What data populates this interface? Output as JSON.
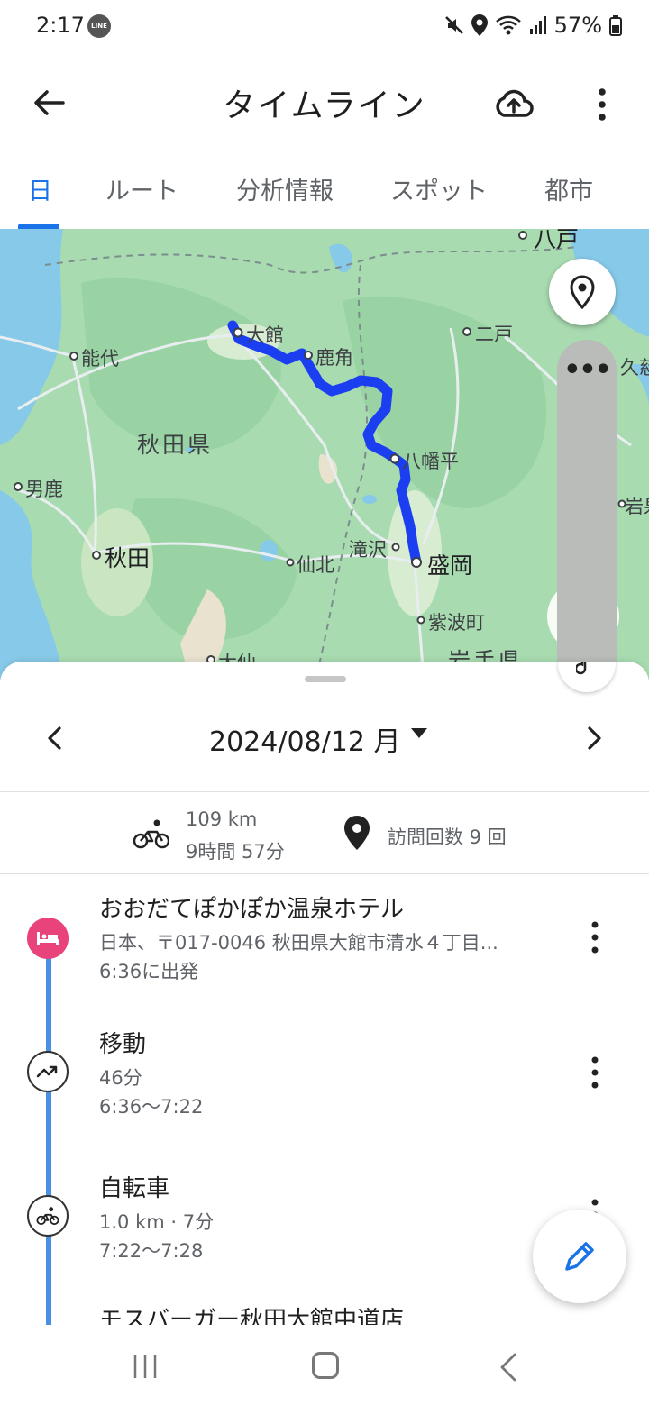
{
  "status_bar": {
    "time": "2:17",
    "line_badge": "LINE",
    "battery": "57%"
  },
  "app_bar": {
    "title": "タイムライン"
  },
  "tabs": [
    {
      "label": "日",
      "selected": true
    },
    {
      "label": "ルート",
      "selected": false
    },
    {
      "label": "分析情報",
      "selected": false
    },
    {
      "label": "スポット",
      "selected": false
    },
    {
      "label": "都市",
      "selected": false
    }
  ],
  "map": {
    "labels": {
      "hachinohe": "八戸",
      "odate": "大館",
      "noshiro": "能代",
      "kazuno": "鹿角",
      "ninohe": "二戸",
      "kuji": "久慈",
      "akita_pref": "秋田県",
      "hachimantai": "八幡平",
      "oga": "男鹿",
      "iwaizumi": "岩泉",
      "akita": "秋田",
      "takizawa": "滝沢",
      "morioka": "盛岡",
      "semboku": "仙北",
      "shiwa": "紫波町",
      "daisen": "大仙",
      "iwate_pref": "岩手県"
    },
    "route_color": "#1a3ef0",
    "overlay_dots": "•••"
  },
  "day": {
    "date": "2024/08/12 月",
    "distance": "109 km",
    "duration": "9時間 57分",
    "visits": "訪問回数 9 回"
  },
  "timeline": [
    {
      "type": "hotel",
      "icon": "hotel-icon",
      "title": "おおだてぽかぽか温泉ホテル",
      "line1": "日本、〒017-0046 秋田県大館市清水４丁目...",
      "line2": "6:36に出発"
    },
    {
      "type": "move",
      "icon": "moving-icon",
      "title": "移動",
      "line1": "46分",
      "line2": "6:36〜7:22"
    },
    {
      "type": "bicycle",
      "icon": "bicycle-icon",
      "title": "自転車",
      "line1": "1.0 km · 7分",
      "line2": "7:22〜7:28"
    },
    {
      "type": "place",
      "icon": "",
      "title": "モスバーガー秋田大館中道店"
    }
  ],
  "colors": {
    "accent": "#1a73e8",
    "hotel": "#e8437a",
    "timeline": "#4a90e2"
  }
}
